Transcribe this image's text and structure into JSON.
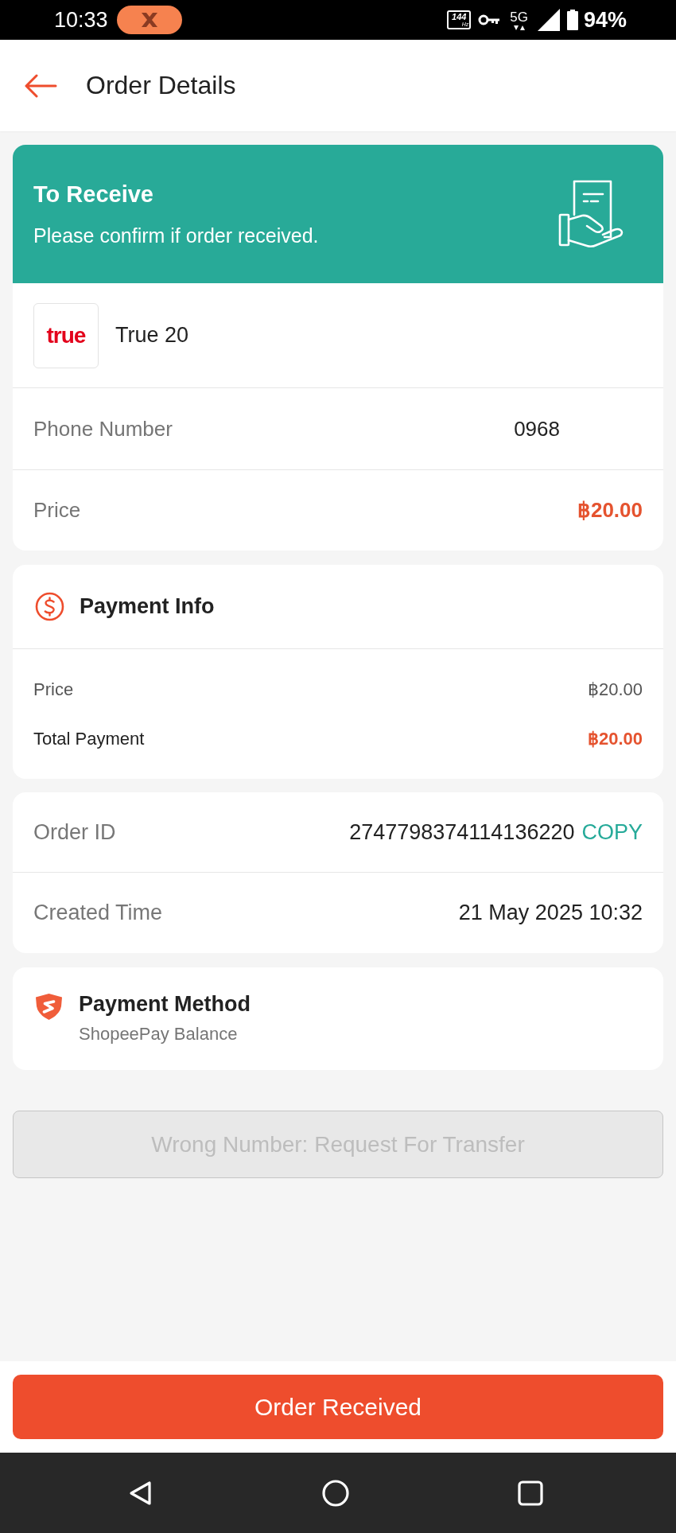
{
  "status_bar": {
    "time": "10:33",
    "refresh_rate": {
      "value": "144",
      "unit": "Hz"
    },
    "network": "5G",
    "battery": "94%"
  },
  "header": {
    "title": "Order Details"
  },
  "status_card": {
    "title": "To Receive",
    "message": "Please confirm if order received."
  },
  "product": {
    "logo_text": "true",
    "name": "True 20"
  },
  "details": [
    {
      "label": "Phone Number",
      "value": "0968",
      "kind": "plain"
    },
    {
      "label": "Price",
      "value": "฿20.00",
      "kind": "highlight"
    }
  ],
  "payment_info": {
    "title": "Payment Info",
    "rows": [
      {
        "label": "Price",
        "value": "฿20.00",
        "kind": "plain"
      },
      {
        "label": "Total Payment",
        "value": "฿20.00",
        "kind": "total"
      }
    ]
  },
  "order": {
    "rows": [
      {
        "label": "Order ID",
        "value": "2747798374114136220",
        "action": "COPY"
      },
      {
        "label": "Created Time",
        "value": "21 May 2025 10:32"
      }
    ]
  },
  "payment_method": {
    "title": "Payment Method",
    "value": "ShopeePay Balance"
  },
  "transfer_button": {
    "label": "Wrong Number: Request For Transfer",
    "disabled": true
  },
  "primary_button": {
    "label": "Order Received"
  }
}
